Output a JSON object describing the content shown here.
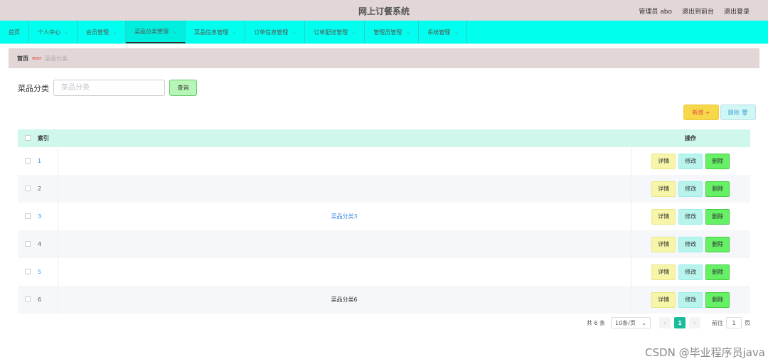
{
  "header": {
    "title": "网上订餐系统",
    "user": "管理员 abo",
    "back_front": "退出到前台",
    "logout": "退出登录"
  },
  "nav": {
    "items": [
      {
        "label": "首页",
        "dropdown": false,
        "active": false
      },
      {
        "label": "个人中心",
        "dropdown": true,
        "active": false
      },
      {
        "label": "会员管理",
        "dropdown": true,
        "active": false
      },
      {
        "label": "菜品分类管理",
        "dropdown": true,
        "active": true
      },
      {
        "label": "菜品信息管理",
        "dropdown": true,
        "active": false
      },
      {
        "label": "订单信息管理",
        "dropdown": true,
        "active": false
      },
      {
        "label": "订单配送管理",
        "dropdown": true,
        "active": false
      },
      {
        "label": "管理员管理",
        "dropdown": true,
        "active": false
      },
      {
        "label": "系统管理",
        "dropdown": true,
        "active": false
      }
    ]
  },
  "breadcrumb": {
    "home": "首页",
    "current": "菜品分类"
  },
  "search": {
    "label": "菜品分类",
    "placeholder": "菜品分类",
    "value": "",
    "query_button": "查询"
  },
  "toolbar": {
    "add_label": "新增 +",
    "delete_label": "删除 🗑"
  },
  "table": {
    "headers": {
      "index": "索引",
      "operation": "操作"
    },
    "rows": [
      {
        "index": "1",
        "name": ""
      },
      {
        "index": "2",
        "name": ""
      },
      {
        "index": "3",
        "name": "菜品分类3"
      },
      {
        "index": "4",
        "name": ""
      },
      {
        "index": "5",
        "name": ""
      },
      {
        "index": "6",
        "name": "菜品分类6"
      }
    ],
    "op_labels": {
      "detail": "详情",
      "edit": "修改",
      "delete": "删除"
    }
  },
  "pagination": {
    "total": "共 6 条",
    "page_size": "10条/页",
    "current_page": "1",
    "goto_prefix": "前往",
    "goto_value": "1",
    "goto_suffix": "页"
  },
  "watermark": "CSDN @毕业程序员java"
}
